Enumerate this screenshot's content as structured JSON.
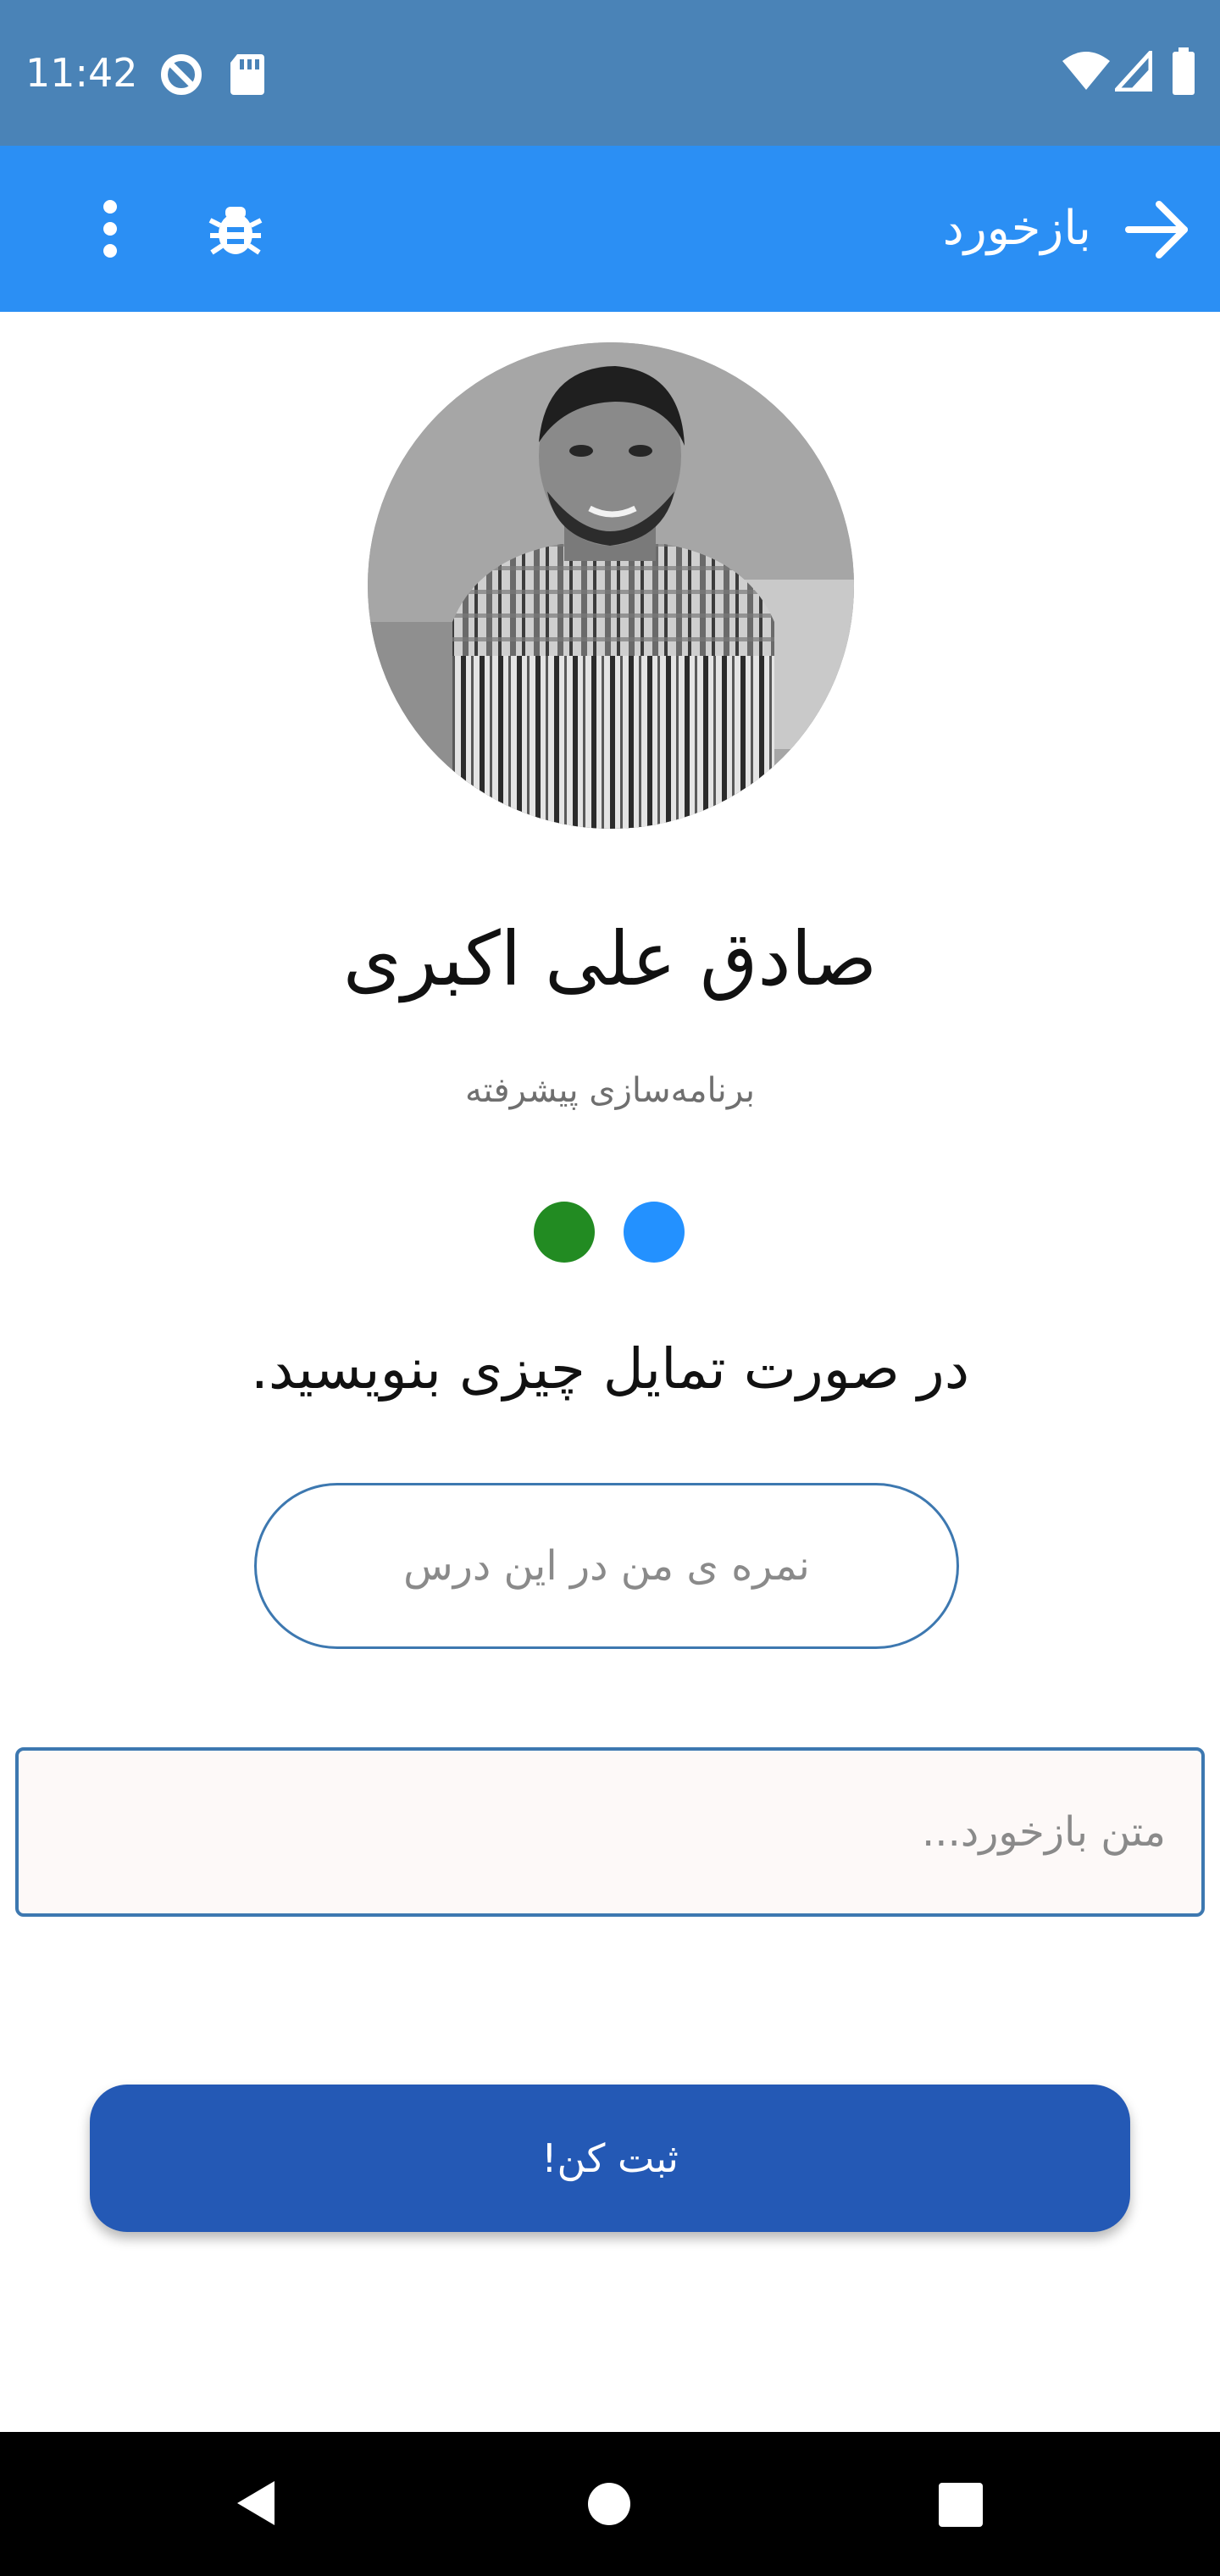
{
  "status_bar": {
    "time": "11:42",
    "icons_left": [
      "do-not-disturb-icon",
      "sd-card-icon"
    ],
    "icons_right": [
      "wifi-icon",
      "cellular-signal-icon",
      "battery-icon"
    ],
    "color": "#4a83b7"
  },
  "app_bar": {
    "title": "بازخورد",
    "back_icon": "arrow-forward-icon",
    "bug_icon": "bug-icon",
    "menu_icon": "more-vertical-icon",
    "color": "#2b8ff4"
  },
  "profile": {
    "name": "صادق علی اکبری",
    "course": "برنامه‌سازی پیشرفته",
    "avatar_icon": "profile-photo"
  },
  "indicators": {
    "colors": [
      "#228b22",
      "#2391ff"
    ]
  },
  "form": {
    "prompt": "در صورت تمایل چیزی بنویسید.",
    "score_placeholder": "نمره ی من در این درس",
    "feedback_placeholder": "متن بازخورد...",
    "submit_label": "ثبت کن!",
    "accent": "#2459b5"
  },
  "nav_bar": {
    "back": "back-triangle-icon",
    "home": "home-circle-icon",
    "recents": "recents-square-icon"
  }
}
